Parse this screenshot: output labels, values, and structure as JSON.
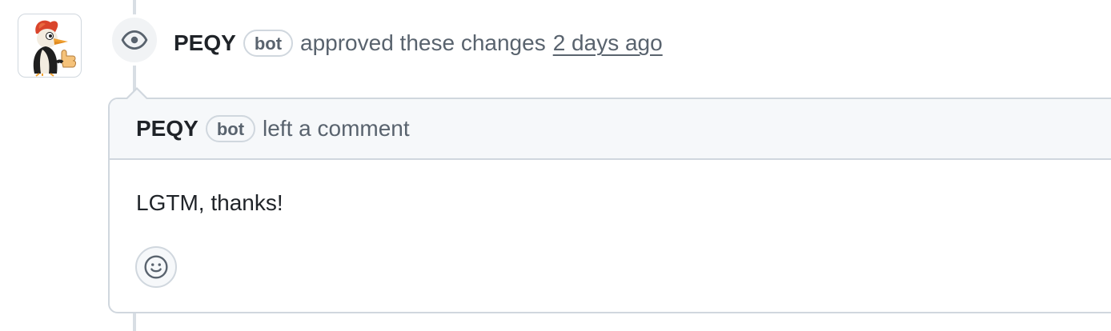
{
  "review_event": {
    "author": "PEQY",
    "author_label": "bot",
    "action_text": "approved these changes",
    "time_text": "2 days ago",
    "event_icon": "eye-icon"
  },
  "comment": {
    "author": "PEQY",
    "author_label": "bot",
    "header_text": "left a comment",
    "body": "LGTM, thanks!",
    "reaction_icon": "smiley-icon"
  },
  "avatar": {
    "icon": "woodpecker-mascot-avatar"
  },
  "colors": {
    "muted_text": "#59636e",
    "border": "#d0d7de",
    "header_bg": "#f6f8fa",
    "timeline": "#d8dee4"
  }
}
